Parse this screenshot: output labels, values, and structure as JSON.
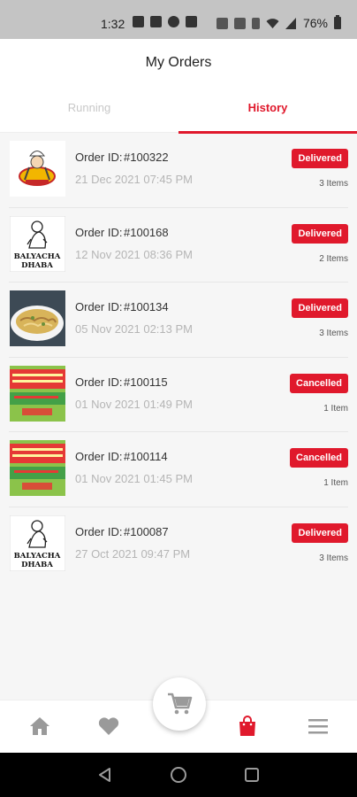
{
  "status_bar": {
    "time": "1:32",
    "battery": "76%",
    "icons": [
      "notification-icon",
      "video-icon",
      "circle-icon",
      "image-icon",
      "data-icon",
      "nfc-icon",
      "vibrate-icon",
      "wifi-icon",
      "signal-icon",
      "battery-icon"
    ]
  },
  "header": {
    "title": "My Orders"
  },
  "tabs": [
    {
      "label": "Running",
      "active": false
    },
    {
      "label": "History",
      "active": true
    }
  ],
  "orders": [
    {
      "id_label": "Order ID:",
      "id": "#100322",
      "date": "21 Dec 2021  07:45 PM",
      "status": "Delivered",
      "items": "3 Items",
      "thumb": "chef-logo"
    },
    {
      "id_label": "Order ID:",
      "id": "#100168",
      "date": "12 Nov 2021  08:36 PM",
      "status": "Delivered",
      "items": "2 Items",
      "thumb": "dhaba-logo"
    },
    {
      "id_label": "Order ID:",
      "id": "#100134",
      "date": "05 Nov 2021  02:13 PM",
      "status": "Delivered",
      "items": "3 Items",
      "thumb": "food-photo"
    },
    {
      "id_label": "Order ID:",
      "id": "#100115",
      "date": "01 Nov 2021  01:49 PM",
      "status": "Cancelled",
      "items": "1 Item",
      "thumb": "red-sign-logo"
    },
    {
      "id_label": "Order ID:",
      "id": "#100114",
      "date": "01 Nov 2021  01:45 PM",
      "status": "Cancelled",
      "items": "1 Item",
      "thumb": "red-sign-logo"
    },
    {
      "id_label": "Order ID:",
      "id": "#100087",
      "date": "27 Oct 2021  09:47 PM",
      "status": "Delivered",
      "items": "3 Items",
      "thumb": "dhaba-logo"
    }
  ],
  "thumb_text": {
    "dhaba_line1": "BALYACHA",
    "dhaba_line2": "DHABA"
  },
  "colors": {
    "accent": "#e0192c",
    "inactive": "#9a9a9a",
    "status_bar": "#c4c4c4"
  },
  "bottom_nav": [
    "home-icon",
    "favorite-icon",
    "cart-icon",
    "orders-icon",
    "menu-icon"
  ]
}
